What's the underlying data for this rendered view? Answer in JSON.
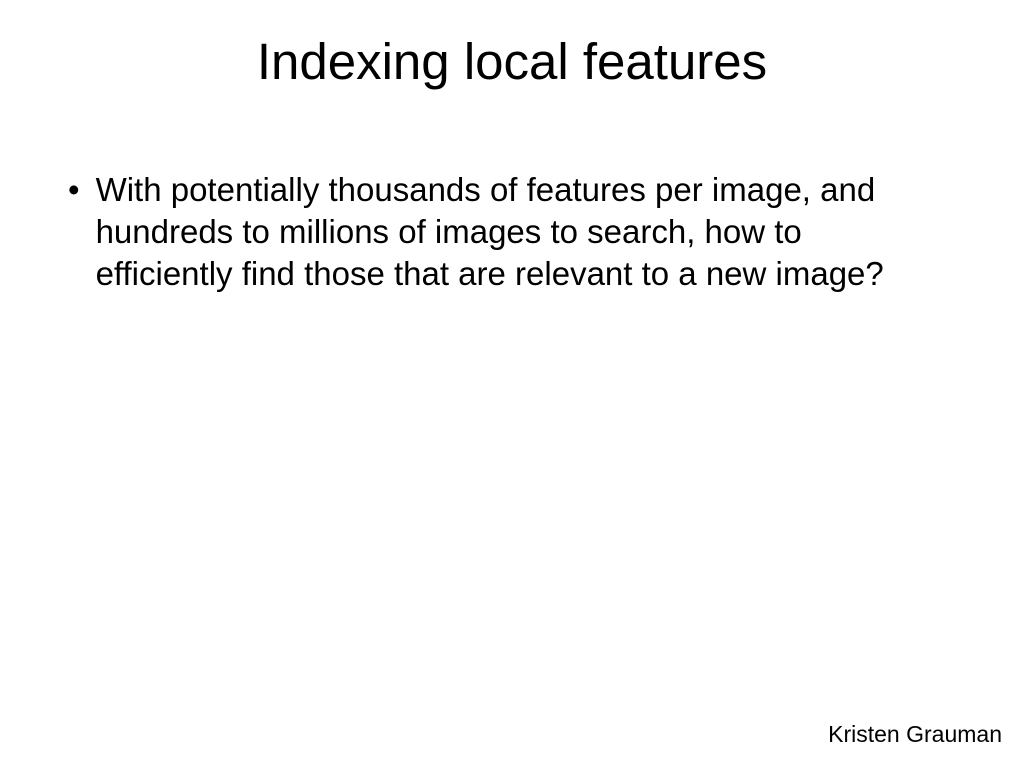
{
  "slide": {
    "title": "Indexing local features",
    "bullets": [
      "With potentially thousands of features per image, and hundreds to millions of images to search, how to efficiently find those that are relevant to a new image?"
    ],
    "author": "Kristen Grauman"
  }
}
